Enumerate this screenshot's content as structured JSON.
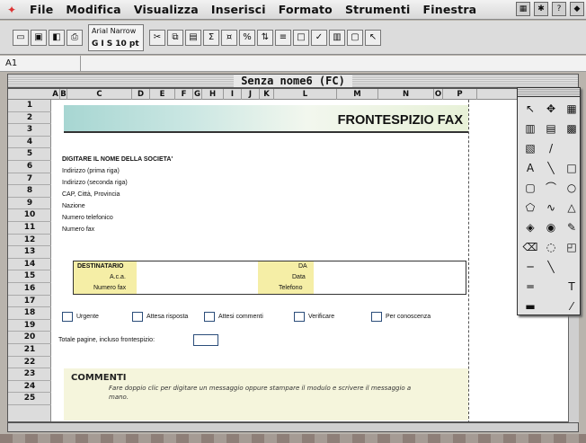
{
  "menubar": {
    "items": [
      "File",
      "Modifica",
      "Visualizza",
      "Inserisci",
      "Formato",
      "Strumenti",
      "Finestra"
    ]
  },
  "toolbar": {
    "font_name": "Arial Narrow",
    "bold": "G",
    "italic": "I",
    "style": "S",
    "font_size": "10 pt"
  },
  "formula": {
    "cell_ref": "A1",
    "value": ""
  },
  "window": {
    "title": "Senza nome6 (FC)"
  },
  "columns": [
    "A",
    "B",
    "C",
    "D",
    "E",
    "F",
    "G",
    "H",
    "I",
    "J",
    "K",
    "L",
    "M",
    "N",
    "O",
    "P"
  ],
  "rows": [
    "1",
    "2",
    "3",
    "4",
    "5",
    "6",
    "7",
    "8",
    "9",
    "10",
    "11",
    "12",
    "13",
    "14",
    "15",
    "16",
    "17",
    "18",
    "19",
    "20",
    "21",
    "22",
    "23",
    "24",
    "25"
  ],
  "sheet": {
    "header": "FRONTESPIZIO FAX",
    "company": "DIGITARE IL NOME DELLA SOCIETA'",
    "address1": "Indirizzo (prima riga)",
    "address2": "Indirizzo (seconda riga)",
    "city": "CAP, Città, Provincia",
    "country": "Nazione",
    "phone": "Numero telefonico",
    "fax": "Numero fax",
    "recipient": "DESTINATARIO",
    "attn": "A.c.a.",
    "faxno": "Numero fax",
    "from": "DA",
    "date": "Data",
    "tel": "Telefono",
    "checkboxes": [
      "Urgente",
      "Attesa risposta",
      "Attesi commenti",
      "Verificare",
      "Per conoscenza"
    ],
    "pages": "Totale pagine, incluso frontespizio:",
    "comments_title": "COMMENTI",
    "comments_text": "Fare doppio clic per digitare un messaggio oppure stampare il modulo e scrivere il messaggio a mano."
  }
}
